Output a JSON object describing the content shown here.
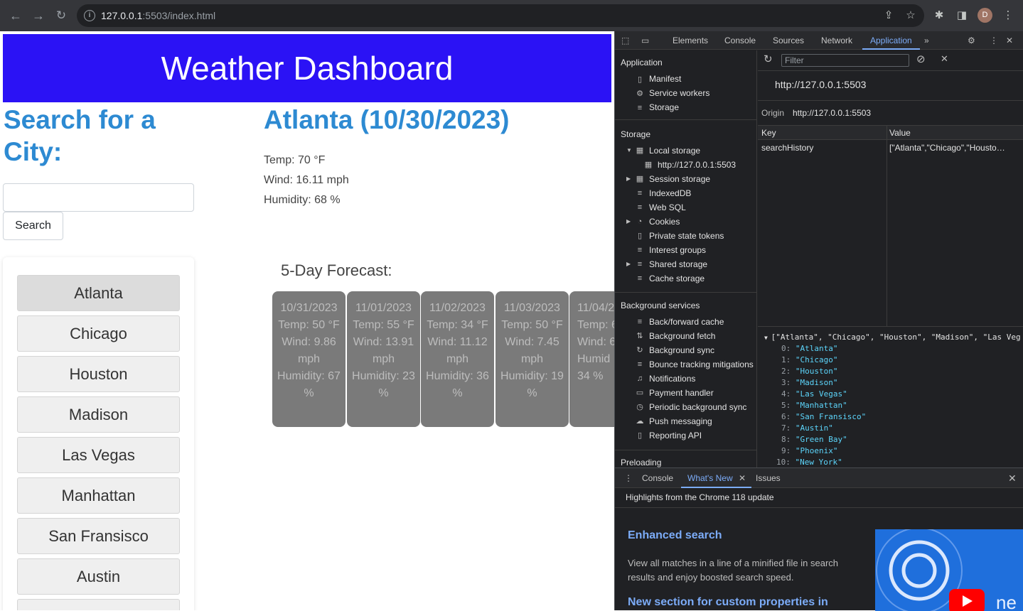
{
  "browser": {
    "url_host": "127.0.0.1",
    "url_rest": ":5503/index.html",
    "avatar": "D"
  },
  "app": {
    "title": "Weather Dashboard",
    "search_title": "Search for a City:",
    "search_input_value": "",
    "search_button": "Search",
    "history": [
      "Atlanta",
      "Chicago",
      "Houston",
      "Madison",
      "Las Vegas",
      "Manhattan",
      "San Fransisco",
      "Austin"
    ],
    "current": {
      "title": "Atlanta (10/30/2023)",
      "temp": "Temp: 70 °F",
      "wind": "Wind: 16.11 mph",
      "humidity": "Humidity: 68 %"
    },
    "forecast_title": "5-Day Forecast:",
    "forecast": [
      {
        "date": "10/31/2023",
        "temp": "Temp: 50 °F",
        "wind": "Wind: 9.86 mph",
        "humidity": "Humidity: 67 %"
      },
      {
        "date": "11/01/2023",
        "temp": "Temp: 55 °F",
        "wind": "Wind: 13.91 mph",
        "humidity": "Humidity: 23 %"
      },
      {
        "date": "11/02/2023",
        "temp": "Temp: 34 °F",
        "wind": "Wind: 11.12 mph",
        "humidity": "Humidity: 36 %"
      },
      {
        "date": "11/03/2023",
        "temp": "Temp: 50 °F",
        "wind": "Wind: 7.45 mph",
        "humidity": "Humidity: 19 %"
      },
      {
        "date": "11/04/2",
        "temp": "Temp: 6",
        "wind": "Wind: 6",
        "humidity": "Humid 34 %"
      }
    ]
  },
  "devtools": {
    "tabs": [
      "Elements",
      "Console",
      "Sources",
      "Network",
      "Application"
    ],
    "active_tab": "Application",
    "sidebar": {
      "application_header": "Application",
      "application_items": [
        "Manifest",
        "Service workers",
        "Storage"
      ],
      "storage_header": "Storage",
      "storage_items": [
        "Local storage",
        "http://127.0.0.1:5503",
        "Session storage",
        "IndexedDB",
        "Web SQL",
        "Cookies",
        "Private state tokens",
        "Interest groups",
        "Shared storage",
        "Cache storage"
      ],
      "background_header": "Background services",
      "background_items": [
        "Back/forward cache",
        "Background fetch",
        "Background sync",
        "Bounce tracking mitigations",
        "Notifications",
        "Payment handler",
        "Periodic background sync",
        "Push messaging",
        "Reporting API"
      ],
      "preloading_header": "Preloading"
    },
    "filter_placeholder": "Filter",
    "origin_url": "http://127.0.0.1:5503",
    "origin_label": "Origin",
    "origin_value": "http://127.0.0.1:5503",
    "key_header": "Key",
    "value_header": "Value",
    "row_key": "searchHistory",
    "row_value": "[\"Atlanta\",\"Chicago\",\"Housto…",
    "preview_head": "[\"Atlanta\", \"Chicago\", \"Houston\", \"Madison\", \"Las Veg",
    "preview_items": [
      "\"Atlanta\"",
      "\"Chicago\"",
      "\"Houston\"",
      "\"Madison\"",
      "\"Las Vegas\"",
      "\"Manhattan\"",
      "\"San Fransisco\"",
      "\"Austin\"",
      "\"Green Bay\"",
      "\"Phoenix\"",
      "\"New York\""
    ],
    "drawer_tabs": [
      "Console",
      "What's New",
      "Issues"
    ],
    "whats_new": {
      "highlight": "Highlights from the Chrome 118 update",
      "h1": "Enhanced search",
      "p": "View all matches in a line of a minified file in search results and enjoy boosted search speed.",
      "h2": "New section for custom properties in",
      "img_text": "ne"
    }
  }
}
